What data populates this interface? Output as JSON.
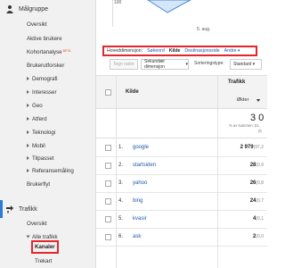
{
  "sidebar": {
    "section1_title": "Målgruppe",
    "items": [
      {
        "label": "Oversikt"
      },
      {
        "label": "Aktive brukere"
      },
      {
        "label": "Kohortanalyse",
        "badge": "BETA"
      },
      {
        "label": "Brukerutforsker"
      },
      {
        "label": "Demografi"
      },
      {
        "label": "Interesser"
      },
      {
        "label": "Geo"
      },
      {
        "label": "Atferd"
      },
      {
        "label": "Teknologi"
      },
      {
        "label": "Mobil"
      },
      {
        "label": "Tilpasset"
      },
      {
        "label": "Referansemåling"
      },
      {
        "label": "Brukerflyt"
      }
    ],
    "section2_title": "Trafikk",
    "traffic_items": [
      {
        "label": "Oversikt"
      },
      {
        "label": "Alle trafikk"
      },
      {
        "label": "Kanaler"
      },
      {
        "label": "Trekart"
      }
    ]
  },
  "chart": {
    "tick_top": "100",
    "date_label": "5. aug."
  },
  "dimension_bar": {
    "label": "Hoveddimensjon:",
    "options": [
      "Søkeord",
      "Kilde",
      "Destinasjonsside",
      "Andre"
    ],
    "selected": "Kilde"
  },
  "toolbar": {
    "tegn_rader": "Tegn rader",
    "sekundaer": "Sekundær dimensjon",
    "sortering_label": "Sorteringstype:",
    "sortering_value": "Standard"
  },
  "table": {
    "col_source": "Kilde",
    "col_group": "Trafikk",
    "col_metric": "Økter",
    "total_value": "3 0",
    "total_sub1": "% av summen: 51,",
    "total_sub2": "(5",
    "rows": [
      {
        "num": "1.",
        "name": "google",
        "value": "2 979",
        "pct": "(97,2"
      },
      {
        "num": "2.",
        "name": "startsiden",
        "value": "28",
        "pct": "(0,9"
      },
      {
        "num": "3.",
        "name": "yahoo",
        "value": "26",
        "pct": "(0,8"
      },
      {
        "num": "4.",
        "name": "bing",
        "value": "24",
        "pct": "(0,7"
      },
      {
        "num": "5.",
        "name": "kvasir",
        "value": "4",
        "pct": "(0,1"
      },
      {
        "num": "6.",
        "name": "ask",
        "value": "2",
        "pct": "(0,0"
      }
    ]
  },
  "colors": {
    "highlight": "#e3262b",
    "link": "#2158a8",
    "active": "#2b7bd6"
  }
}
